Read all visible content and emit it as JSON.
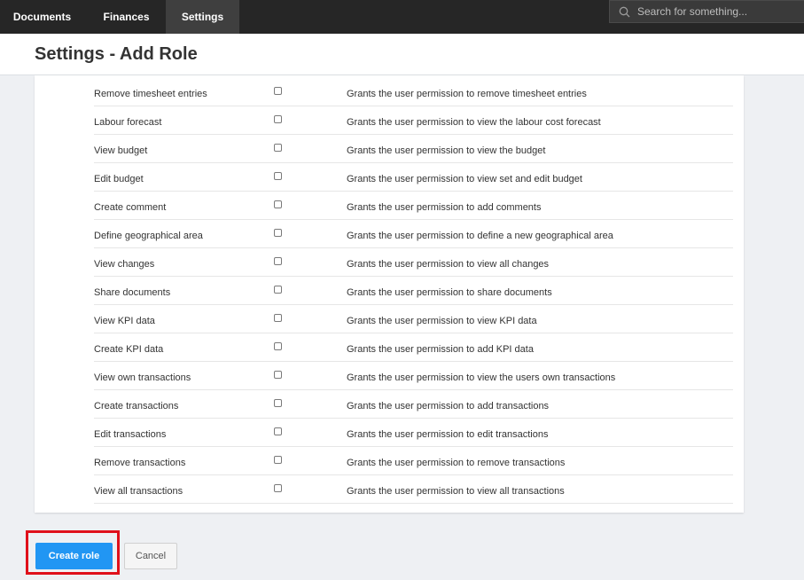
{
  "nav": {
    "tabs": [
      {
        "label": "Documents",
        "active": false
      },
      {
        "label": "Finances",
        "active": false
      },
      {
        "label": "Settings",
        "active": true
      }
    ]
  },
  "search": {
    "placeholder": "Search for something...",
    "icon": "search-icon"
  },
  "page": {
    "title": "Settings - Add Role"
  },
  "permissions": [
    {
      "name": "Remove timesheet entries",
      "description": "Grants the user permission to remove timesheet entries",
      "checked": false
    },
    {
      "name": "Labour forecast",
      "description": "Grants the user permission to view the labour cost forecast",
      "checked": false
    },
    {
      "name": "View budget",
      "description": "Grants the user permission to view the budget",
      "checked": false
    },
    {
      "name": "Edit budget",
      "description": "Grants the user permission to view set and edit budget",
      "checked": false
    },
    {
      "name": "Create comment",
      "description": "Grants the user permission to add comments",
      "checked": false
    },
    {
      "name": "Define geographical area",
      "description": "Grants the user permission to define a new geographical area",
      "checked": false
    },
    {
      "name": "View changes",
      "description": "Grants the user permission to view all changes",
      "checked": false
    },
    {
      "name": "Share documents",
      "description": "Grants the user permission to share documents",
      "checked": false
    },
    {
      "name": "View KPI data",
      "description": "Grants the user permission to view KPI data",
      "checked": false
    },
    {
      "name": "Create KPI data",
      "description": "Grants the user permission to add KPI data",
      "checked": false
    },
    {
      "name": "View own transactions",
      "description": "Grants the user permission to view the users own transactions",
      "checked": false
    },
    {
      "name": "Create transactions",
      "description": "Grants the user permission to add transactions",
      "checked": false
    },
    {
      "name": "Edit transactions",
      "description": "Grants the user permission to edit transactions",
      "checked": false
    },
    {
      "name": "Remove transactions",
      "description": "Grants the user permission to remove transactions",
      "checked": false
    },
    {
      "name": "View all transactions",
      "description": "Grants the user permission to view all transactions",
      "checked": false
    }
  ],
  "actions": {
    "create_label": "Create role",
    "cancel_label": "Cancel"
  },
  "colors": {
    "topbar": "#262626",
    "accent": "#2196f3",
    "highlight": "#e0101a"
  }
}
